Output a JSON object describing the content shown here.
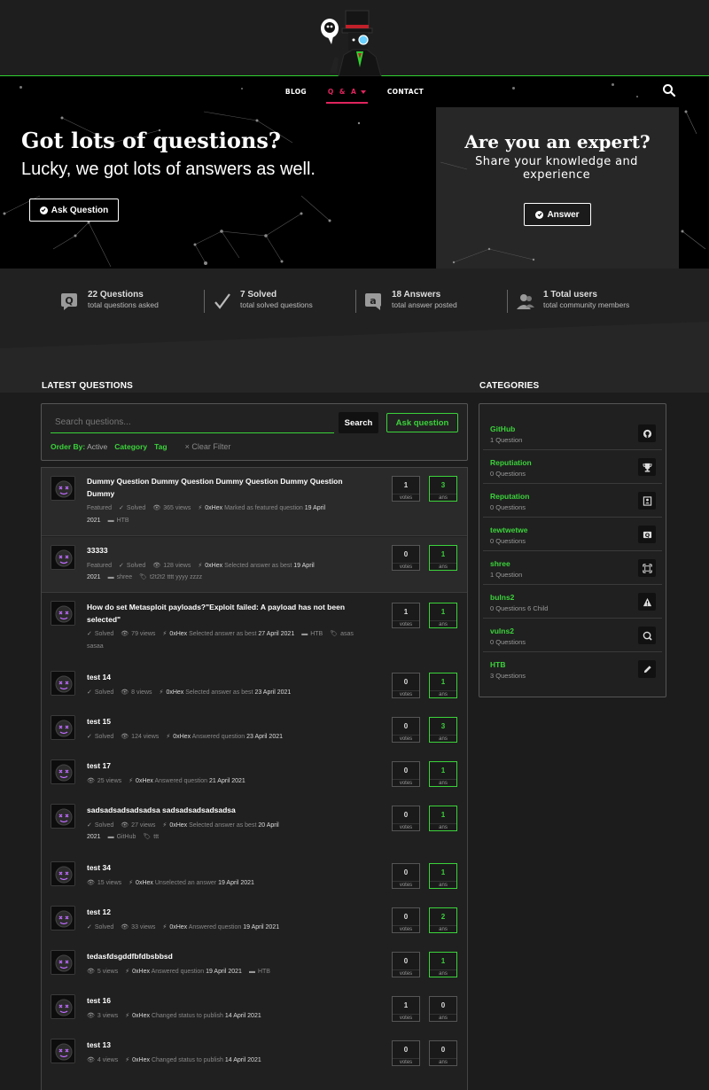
{
  "nav": {
    "items": [
      {
        "label": "BLOG"
      },
      {
        "label": "Q & A"
      },
      {
        "label": "CONTACT"
      }
    ]
  },
  "hero": {
    "title": "Got lots of questions?",
    "subtitle": "Lucky, we got lots of answers as well.",
    "ask_button": "Ask Question",
    "expert_title": "Are you an expert?",
    "expert_sub": "Share your knowledge and experience",
    "answer_button": "Answer"
  },
  "stats": [
    {
      "num": "22 Questions",
      "label": "total questions asked",
      "icon": "question-bubble-icon"
    },
    {
      "num": "7 Solved",
      "label": "total solved questions",
      "icon": "checkmark-icon"
    },
    {
      "num": "18 Answers",
      "label": "total answer posted",
      "icon": "answer-bubble-icon"
    },
    {
      "num": "1 Total users",
      "label": "total community members",
      "icon": "users-icon"
    }
  ],
  "latest": {
    "title": "LATEST QUESTIONS",
    "search_placeholder": "Search questions...",
    "search_button": "Search",
    "ask_button": "Ask question",
    "filters": {
      "order_by": "Order By:",
      "order_value": "Active",
      "category": "Category",
      "tag": "Tag",
      "clear": "Clear Filter"
    }
  },
  "questions": [
    {
      "title": "Dummy Question Dummy Question Dummy Question Dummy Question Dummy",
      "featured": "Featured",
      "solved": "Solved",
      "views": "365 views",
      "user": "0xHex",
      "action": "Marked as featured question",
      "date1": "19 April",
      "date2": "2021",
      "cat": "HTB",
      "tags": "",
      "votes": "1",
      "ans": "3"
    },
    {
      "title": "33333",
      "featured": "Featured",
      "solved": "Solved",
      "views": "128 views",
      "user": "0xHex",
      "action": "Selected answer as best",
      "date1": "19 April",
      "date2": "2021",
      "cat": "shree",
      "tags": "t2t2t2 tttt yyyy zzzz",
      "votes": "0",
      "ans": "1"
    },
    {
      "title": "How do set Metasploit payloads?\"Exploit failed: A payload has not been selected\"",
      "solved": "Solved",
      "views": "79 views",
      "user": "0xHex",
      "action": "Selected answer as best",
      "date1": "27 April 2021",
      "cat": "HTB",
      "tags": "asas",
      "tags2": "sasaa",
      "votes": "1",
      "ans": "1"
    },
    {
      "title": "test 14",
      "solved": "Solved",
      "views": "8 views",
      "user": "0xHex",
      "action": "Selected answer as best",
      "date1": "23 April 2021",
      "votes": "0",
      "ans": "1"
    },
    {
      "title": "test 15",
      "solved": "Solved",
      "views": "124 views",
      "user": "0xHex",
      "action": "Answered question",
      "date1": "23 April 2021",
      "votes": "0",
      "ans": "3"
    },
    {
      "title": "test 17",
      "views": "25 views",
      "user": "0xHex",
      "action": "Answered question",
      "date1": "21 April 2021",
      "votes": "0",
      "ans": "1"
    },
    {
      "title": "sadsadsadsadsadsa sadsadsadsadsadsa",
      "solved": "Solved",
      "views": "27 views",
      "user": "0xHex",
      "action": "Selected answer as best",
      "date1": "20 April",
      "date2": "2021",
      "cat": "GitHub",
      "tags": "ttt",
      "votes": "0",
      "ans": "1"
    },
    {
      "title": "test 34",
      "views": "15 views",
      "user": "0xHex",
      "action": "Unselected an answer",
      "date1": "19 April 2021",
      "votes": "0",
      "ans": "1"
    },
    {
      "title": "test 12",
      "solved": "Solved",
      "views": "33 views",
      "user": "0xHex",
      "action": "Answered question",
      "date1": "19 April 2021",
      "votes": "0",
      "ans": "2"
    },
    {
      "title": "tedasfdsgddfbfdbsbbsd",
      "views": "5 views",
      "user": "0xHex",
      "action": "Answered question",
      "date1": "19 April 2021",
      "cat": "HTB",
      "votes": "0",
      "ans": "1"
    },
    {
      "title": "test 16",
      "views": "3 views",
      "user": "0xHex",
      "action": "Changed status to publish",
      "date1": "14 April 2021",
      "votes": "1",
      "ans": "0"
    },
    {
      "title": "test 13",
      "views": "4 views",
      "user": "0xHex",
      "action": "Changed status to publish",
      "date1": "14 April 2021",
      "votes": "0",
      "ans": "0"
    }
  ],
  "box_labels": {
    "votes": "votes",
    "ans": "ans"
  },
  "categories": {
    "title": "CATEGORIES",
    "items": [
      {
        "name": "GitHub",
        "count": "1 Question",
        "icon": "github-icon"
      },
      {
        "name": "Reputiation",
        "count": "0 Questions",
        "icon": "trophy-icon"
      },
      {
        "name": "Reputation",
        "count": "0 Questions",
        "icon": "contact-card-icon"
      },
      {
        "name": "tewtwetwe",
        "count": "0 Questions",
        "icon": "question-icon"
      },
      {
        "name": "shree",
        "count": "1 Question",
        "icon": "expand-icon"
      },
      {
        "name": "bulns2",
        "count": "0 Questions   6 Child",
        "icon": "warning-icon"
      },
      {
        "name": "vulns2",
        "count": "0 Questions",
        "icon": "magnify-icon"
      },
      {
        "name": "HTB",
        "count": "3 Questions",
        "icon": "pencil-icon"
      }
    ]
  },
  "colors": {
    "accent": "#3bd33b",
    "nav_active": "#e0245e",
    "bg": "#1c1c1c"
  }
}
